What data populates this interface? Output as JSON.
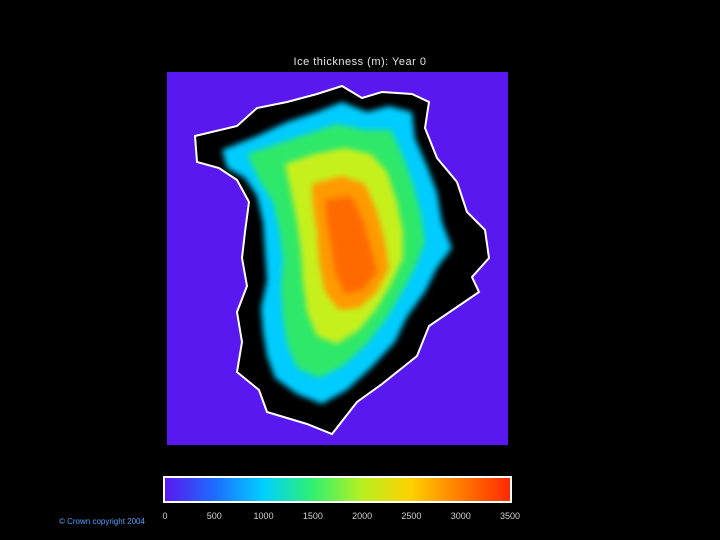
{
  "title": "Ice thickness (m): Year 0",
  "copyright": "© Crown copyright 2004",
  "colors": {
    "background": "#000000",
    "ocean": "#5a18f0",
    "land_edge": "#ffffff",
    "scale": [
      "#5a18f0",
      "#1e6cff",
      "#00d0ff",
      "#30f070",
      "#b8f020",
      "#ffd000",
      "#ff7a00",
      "#ff2a00"
    ]
  },
  "colorbar": {
    "min": 0,
    "max": 3500,
    "ticks": [
      "0",
      "500",
      "1000",
      "1500",
      "2000",
      "2500",
      "3000",
      "3500"
    ]
  }
}
